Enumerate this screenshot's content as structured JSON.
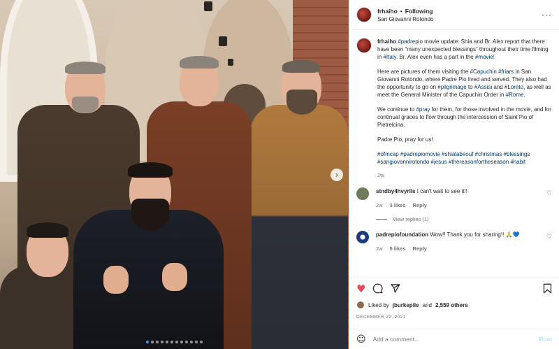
{
  "header": {
    "username": "frhaiho",
    "separator": "•",
    "follow_label": "Following",
    "location": "San Giovanni Rotondo",
    "more_icon": "more-horizontal-icon"
  },
  "caption": {
    "username": "frhaiho",
    "segments": [
      {
        "text": "#padrepio",
        "tag": true
      },
      {
        "text": " movie update: Shia and Br. Alex report that there have been “many unexpected blessings” throughout their time filming in ",
        "tag": false
      },
      {
        "text": "#Italy",
        "tag": true
      },
      {
        "text": ". Br. Alex even has a part in the ",
        "tag": false
      },
      {
        "text": "#movie",
        "tag": true
      },
      {
        "text": "!",
        "tag": false
      }
    ],
    "paragraph2": [
      {
        "text": "Here are pictures of them visiting the ",
        "tag": false
      },
      {
        "text": "#Capuchin",
        "tag": true
      },
      {
        "text": " ",
        "tag": false
      },
      {
        "text": "#friars",
        "tag": true
      },
      {
        "text": " in San Giovanni Rotondo, where Padre Pio lived and served. They also had the opportunity to go on ",
        "tag": false
      },
      {
        "text": "#pilgrimage",
        "tag": true
      },
      {
        "text": " to ",
        "tag": false
      },
      {
        "text": "#Assisi",
        "tag": true
      },
      {
        "text": " and ",
        "tag": false
      },
      {
        "text": "#Loreto",
        "tag": true
      },
      {
        "text": ", as well as meet the General Minister of the Capuchin Order in ",
        "tag": false
      },
      {
        "text": "#Rome",
        "tag": true
      },
      {
        "text": ".",
        "tag": false
      }
    ],
    "paragraph3": [
      {
        "text": "We continue to ",
        "tag": false
      },
      {
        "text": "#pray",
        "tag": true
      },
      {
        "text": " for them, for those involved in the movie, and for continual graces to flow through the intercession of Saint Pio of Pietrelcina.",
        "tag": false
      }
    ],
    "paragraph4": "Padre Pio, pray for us!",
    "hashtags": "#ofmcap #padrepiomovie #shialabeouf #christmas #blessings #sangiovannirotondo #jesus #thereasonfortheseason #habit",
    "age": "2w"
  },
  "comments": [
    {
      "username": "stndby4hvyrlls",
      "text": "I can't wait to see it!!",
      "age": "2w",
      "likes": "3 likes",
      "reply_label": "Reply",
      "view_replies": "View replies (1)",
      "avatar_color": "#6e7a5a"
    },
    {
      "username": "padrepiofoundation",
      "text": "Wow!! Thank you for sharing!! 🙏💙",
      "age": "2w",
      "likes": "5 likes",
      "reply_label": "Reply",
      "avatar_color": "#1d3d7a"
    }
  ],
  "actions": {
    "like_icon": "heart-filled-icon",
    "comment_icon": "comment-icon",
    "share_icon": "share-icon",
    "save_icon": "bookmark-icon"
  },
  "likes": {
    "prefix": "Liked by",
    "user": "jburkepile",
    "and": "and",
    "others": "2,559 others"
  },
  "date": "DECEMBER 22, 2021",
  "add_comment": {
    "placeholder": "Add a comment...",
    "post_label": "Post"
  },
  "carousel": {
    "slide_count": 12,
    "active_index": 0
  },
  "colors": {
    "accent": "#3797f0",
    "hashtag": "#00376b",
    "like": "#ed4956",
    "muted": "#737373"
  }
}
